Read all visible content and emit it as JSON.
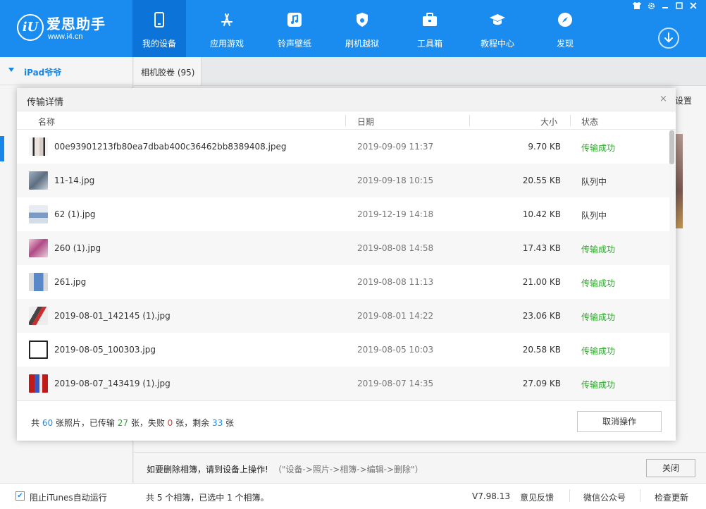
{
  "app": {
    "name": "爱思助手",
    "url": "www.i4.cn",
    "logo_text": "iU"
  },
  "nav": [
    {
      "label": "我的设备",
      "icon": "phone-icon"
    },
    {
      "label": "应用游戏",
      "icon": "app-store-icon"
    },
    {
      "label": "铃声壁纸",
      "icon": "music-note-icon"
    },
    {
      "label": "刷机越狱",
      "icon": "shield-icon"
    },
    {
      "label": "工具箱",
      "icon": "toolbox-icon"
    },
    {
      "label": "教程中心",
      "icon": "graduation-cap-icon"
    },
    {
      "label": "发现",
      "icon": "compass-icon"
    }
  ],
  "sidebar": {
    "device_name": "iPad爷爷"
  },
  "content": {
    "tab_label": "相机胶卷 (95)",
    "settings_link": "设置"
  },
  "dialog": {
    "title": "传输详情",
    "close_glyph": "×",
    "columns": {
      "name": "名称",
      "date": "日期",
      "size": "大小",
      "status": "状态"
    },
    "rows": [
      {
        "name": "00e93901213fb80ea7dbab400c36462bb8389408.jpeg",
        "date": "2019-09-09 11:37",
        "size": "9.70 KB",
        "status": "传输成功"
      },
      {
        "name": "11-14.jpg",
        "date": "2019-09-18 10:15",
        "size": "20.55 KB",
        "status": "队列中"
      },
      {
        "name": "62 (1).jpg",
        "date": "2019-12-19 14:18",
        "size": "10.42 KB",
        "status": "队列中"
      },
      {
        "name": "260 (1).jpg",
        "date": "2019-08-08 14:58",
        "size": "17.43 KB",
        "status": "传输成功"
      },
      {
        "name": "261.jpg",
        "date": "2019-08-08 11:13",
        "size": "21.00 KB",
        "status": "传输成功"
      },
      {
        "name": "2019-08-01_142145 (1).jpg",
        "date": "2019-08-01 14:22",
        "size": "23.06 KB",
        "status": "传输成功"
      },
      {
        "name": "2019-08-05_100303.jpg",
        "date": "2019-08-05 10:03",
        "size": "20.58 KB",
        "status": "传输成功"
      },
      {
        "name": "2019-08-07_143419 (1).jpg",
        "date": "2019-08-07 14:35",
        "size": "27.09 KB",
        "status": "传输成功"
      }
    ],
    "summary": {
      "prefix": "共 ",
      "total": "60",
      "t1": " 张照片，已传输 ",
      "done": "27",
      "t2": " 张，失败 ",
      "failed": "0",
      "t3": " 张，剩余 ",
      "remaining": "33",
      "t4": " 张"
    },
    "cancel_label": "取消操作"
  },
  "bottom": {
    "hint": "如要删除相簿，请到设备上操作!",
    "path_hint": "（\"设备->照片->相簿->编辑->删除\"）",
    "close_label": "关闭"
  },
  "status_bar": {
    "itunes_label": "阻止iTunes自动运行",
    "itunes_checked": "✔",
    "album_count": "共 5 个相簿，已选中 1 个相簿。",
    "version": "V7.98.13",
    "feedback": "意见反馈",
    "wechat": "微信公众号",
    "update": "检查更新"
  },
  "colors": {
    "accent": "#1a8cf0",
    "success": "#2aa52a",
    "failed": "#e53935"
  }
}
